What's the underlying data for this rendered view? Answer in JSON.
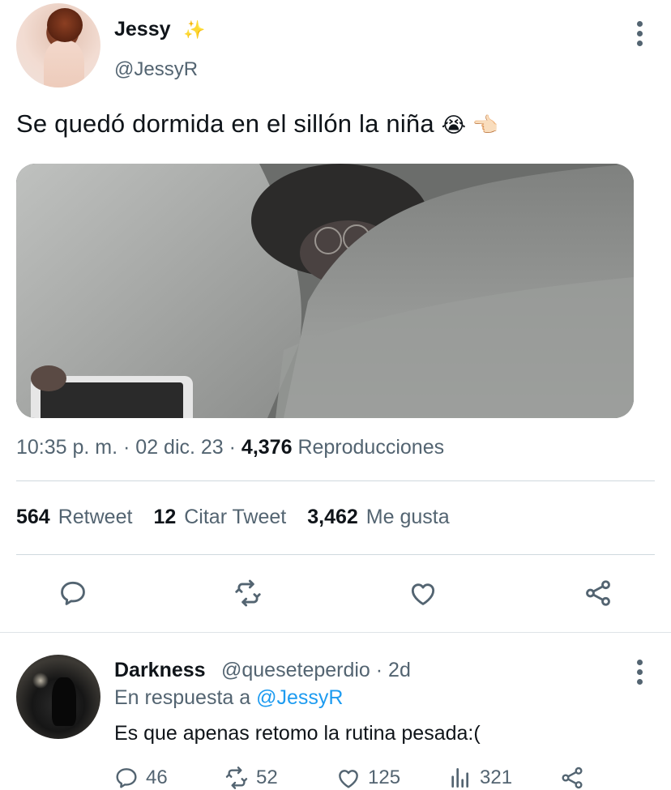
{
  "tweet": {
    "author_name": "Jessy",
    "author_badge_emoji": "✨",
    "author_handle": "@JessyR",
    "text": "Se quedó dormida en el sillón la niña",
    "text_emojis": "😭 👈🏻",
    "timestamp": "10:35 p. m. · 02 dic. 23 · ",
    "views_count": "4,376",
    "views_label": "Reproducciones",
    "stats": {
      "retweets_count": "564",
      "retweets_label": "Retweet",
      "quotes_count": "12",
      "quotes_label": "Citar Tweet",
      "likes_count": "3,462",
      "likes_label": "Me gusta"
    },
    "actions": [
      "reply-icon",
      "retweet-icon",
      "like-icon",
      "share-icon"
    ]
  },
  "reply": {
    "author_name": "Darkness",
    "author_handle_time": "@queseteperdio · 2d",
    "replying_prefix": "En respuesta a ",
    "replying_mention": "@JessyR",
    "text": "Es que apenas retomo la rutina pesada:(",
    "counts": {
      "replies": "46",
      "retweets": "52",
      "likes": "125",
      "views": "321"
    }
  },
  "colors": {
    "text": "#0f1419",
    "secondary": "#536471",
    "accent": "#1d9bf0",
    "divider": "#cfd9de"
  }
}
